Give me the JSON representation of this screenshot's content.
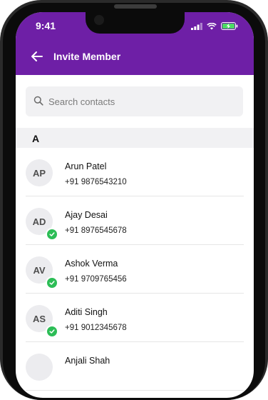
{
  "status_bar": {
    "time": "9:41"
  },
  "header": {
    "title": "Invite Member"
  },
  "search": {
    "placeholder": "Search contacts"
  },
  "section": {
    "letter": "A"
  },
  "contacts": [
    {
      "initials": "AP",
      "name": "Arun Patel",
      "phone": "+91 9876543210",
      "selected": false
    },
    {
      "initials": "AD",
      "name": "Ajay Desai",
      "phone": "+91 8976545678",
      "selected": true
    },
    {
      "initials": "AV",
      "name": "Ashok Verma",
      "phone": "+91 9709765456",
      "selected": true
    },
    {
      "initials": "AS",
      "name": "Aditi Singh",
      "phone": "+91 9012345678",
      "selected": true
    },
    {
      "initials": "",
      "name": "Anjali Shah",
      "phone": "",
      "selected": false
    }
  ],
  "colors": {
    "header": "#6e1fa6",
    "check": "#2cbd56",
    "battery": "#4cd964"
  },
  "icons": {
    "back": "arrow-left-icon",
    "search": "search-icon",
    "check": "check-icon",
    "signal": "signal-icon",
    "wifi": "wifi-icon",
    "battery": "battery-charging-icon"
  }
}
